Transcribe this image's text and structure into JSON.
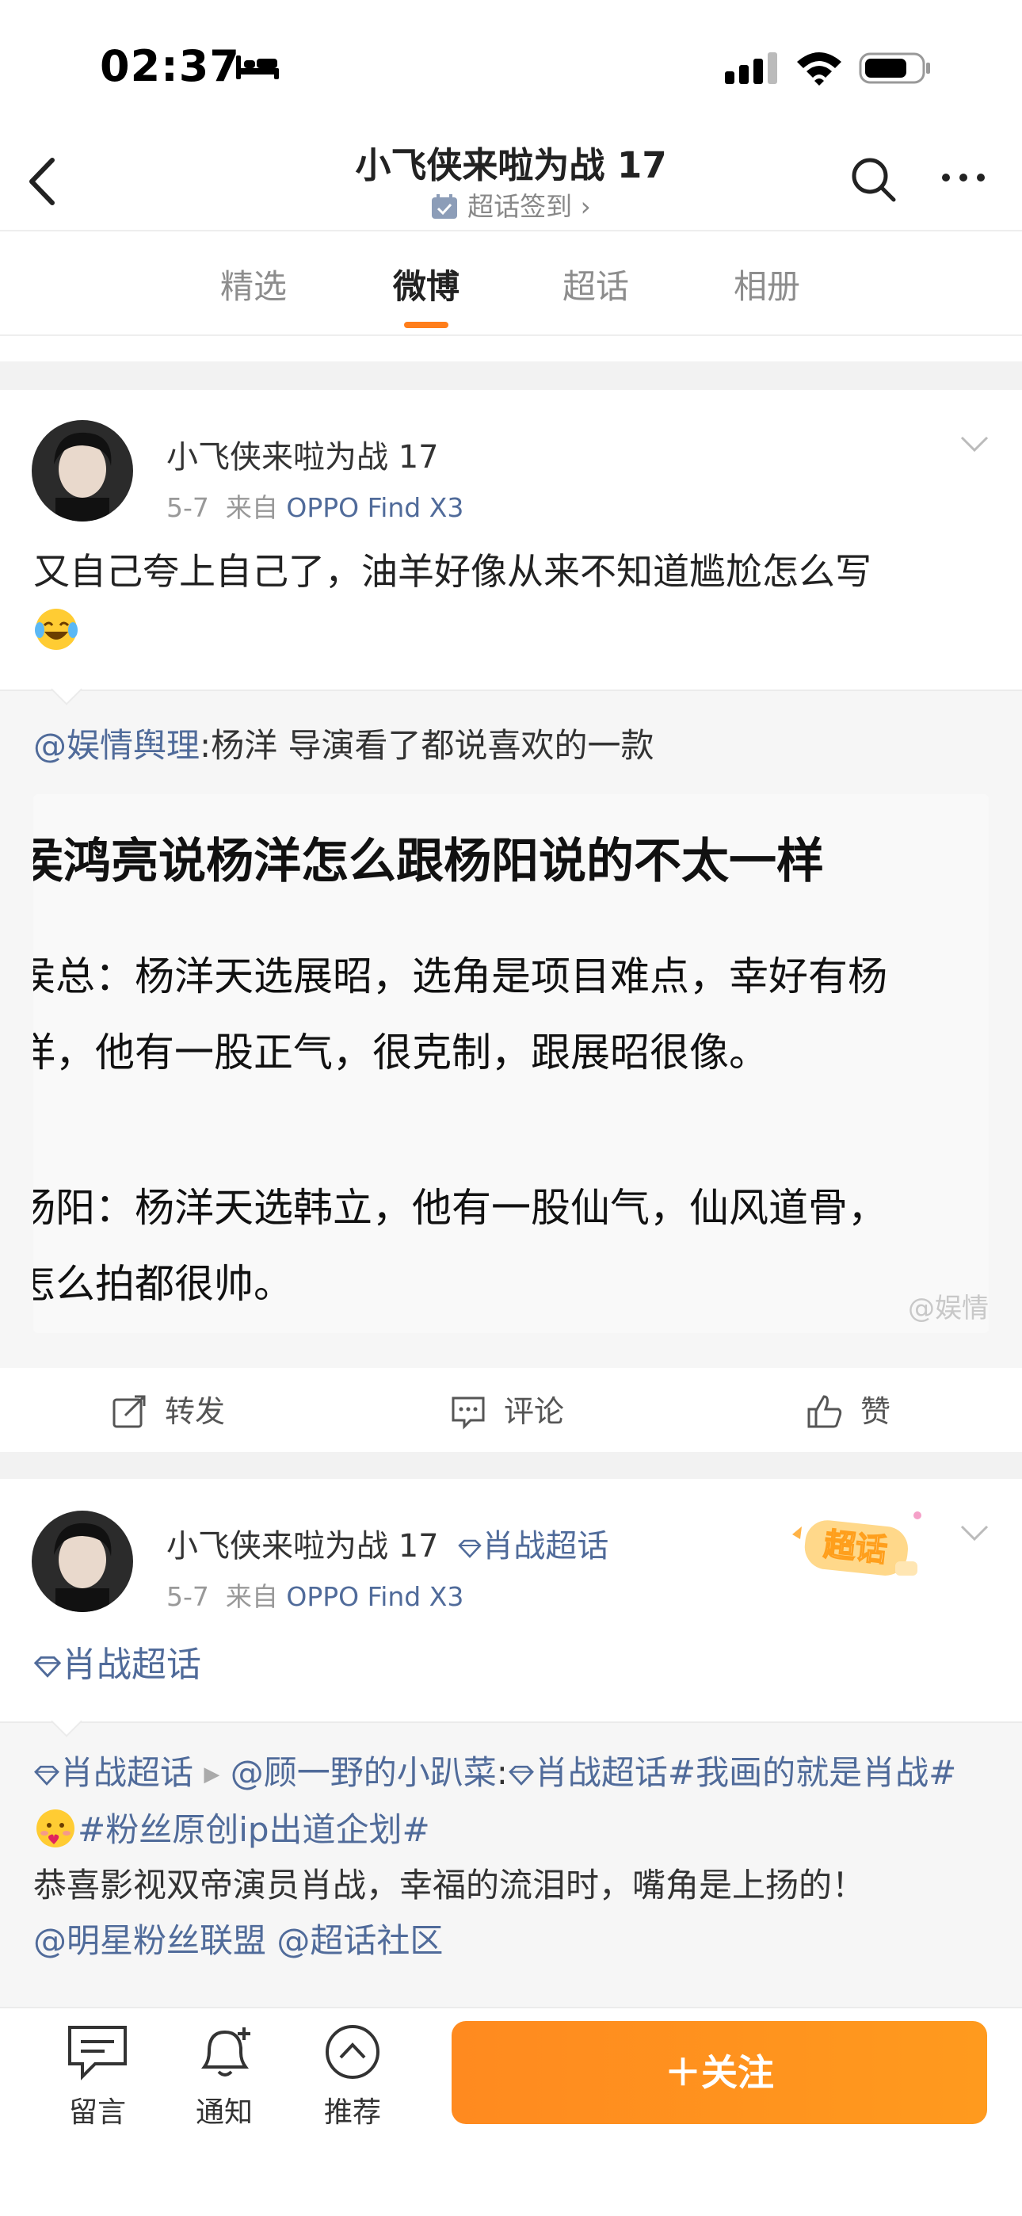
{
  "status_bar": {
    "time": "02:37"
  },
  "nav": {
    "title": "小飞侠来啦为战 17",
    "subtitle": "超话签到 ›"
  },
  "tabs": [
    {
      "label": "精选",
      "active": false
    },
    {
      "label": "微博",
      "active": true
    },
    {
      "label": "超话",
      "active": false
    },
    {
      "label": "相册",
      "active": false
    }
  ],
  "accent_color": "#ff7e1b",
  "link_color": "#506b9a",
  "posts": [
    {
      "author": "小飞侠来啦为战 17",
      "date": "5-7",
      "from_label": "来自",
      "source": "OPPO Find X3",
      "text": "又自己夸上自己了，油羊好像从来不知道尴尬怎么写",
      "emoji": "crying-laughing-emoji",
      "retweet": {
        "user": "@娱情舆理",
        "text": ":杨洋 导演看了都说喜欢的一款",
        "image_lines": [
          "侯鸿亮说杨洋怎么跟杨阳说的不太一样",
          "侯总：杨洋天选展昭，选角是项目难点，幸好有杨",
          "洋，他有一股正气，很克制，跟展昭很像。",
          "杨阳：杨洋天选韩立，他有一股仙气，仙风道骨，",
          "怎么拍都很帅。"
        ],
        "image_watermark": "@娱情"
      },
      "actions": {
        "repost": "转发",
        "comment": "评论",
        "like": "赞"
      }
    },
    {
      "author": "小飞侠来啦为战 17",
      "topic_tag": "肖战超话",
      "date": "5-7",
      "from_label": "来自",
      "source": "OPPO Find X3",
      "badge": "超话",
      "text": "肖战超话",
      "retweet": {
        "topic": "肖战超话",
        "user": "@顾一野的小趴菜",
        "inline_topic": "肖战超话",
        "hashtag1": "#我画的就是肖战#",
        "hashtag2": "#粉丝原创ip出道企划#",
        "body": "恭喜影视双帝演员肖战，幸福的流泪时，嘴角是上扬的！",
        "mention1": "@明星粉丝联盟",
        "mention2": "@超话社区"
      }
    }
  ],
  "bottom_bar": {
    "message": "留言",
    "notify": "通知",
    "recommend": "推荐",
    "follow": "＋关注"
  }
}
